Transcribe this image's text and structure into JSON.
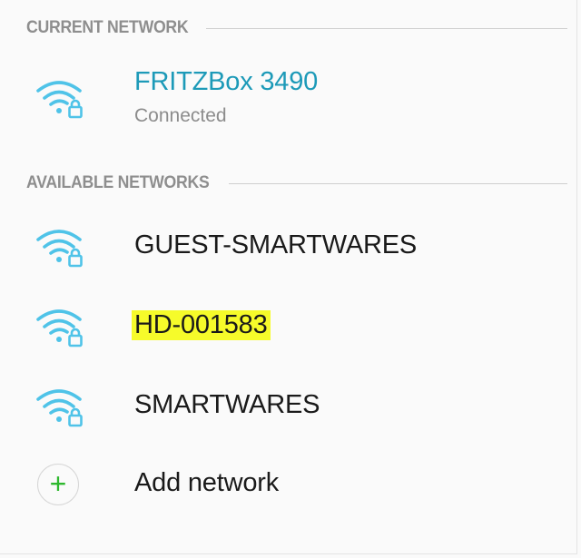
{
  "current_section": {
    "header": "CURRENT NETWORK",
    "network": {
      "name": "FRITZBox 3490",
      "status": "Connected",
      "icon": "wifi-lock-icon"
    }
  },
  "available_section": {
    "header": "AVAILABLE NETWORKS",
    "networks": [
      {
        "name": "GUEST-SMARTWARES",
        "icon": "wifi-lock-icon"
      },
      {
        "name": "HD-001583",
        "icon": "wifi-lock-icon",
        "highlighted": true
      },
      {
        "name": "SMARTWARES",
        "icon": "wifi-lock-icon"
      }
    ]
  },
  "add_network": {
    "label": "Add network",
    "icon": "plus-icon"
  },
  "colors": {
    "wifi_icon": "#4fc3e8",
    "current_name": "#1d9ab8",
    "highlight": "#f6fb2a",
    "plus": "#2eb82e"
  }
}
